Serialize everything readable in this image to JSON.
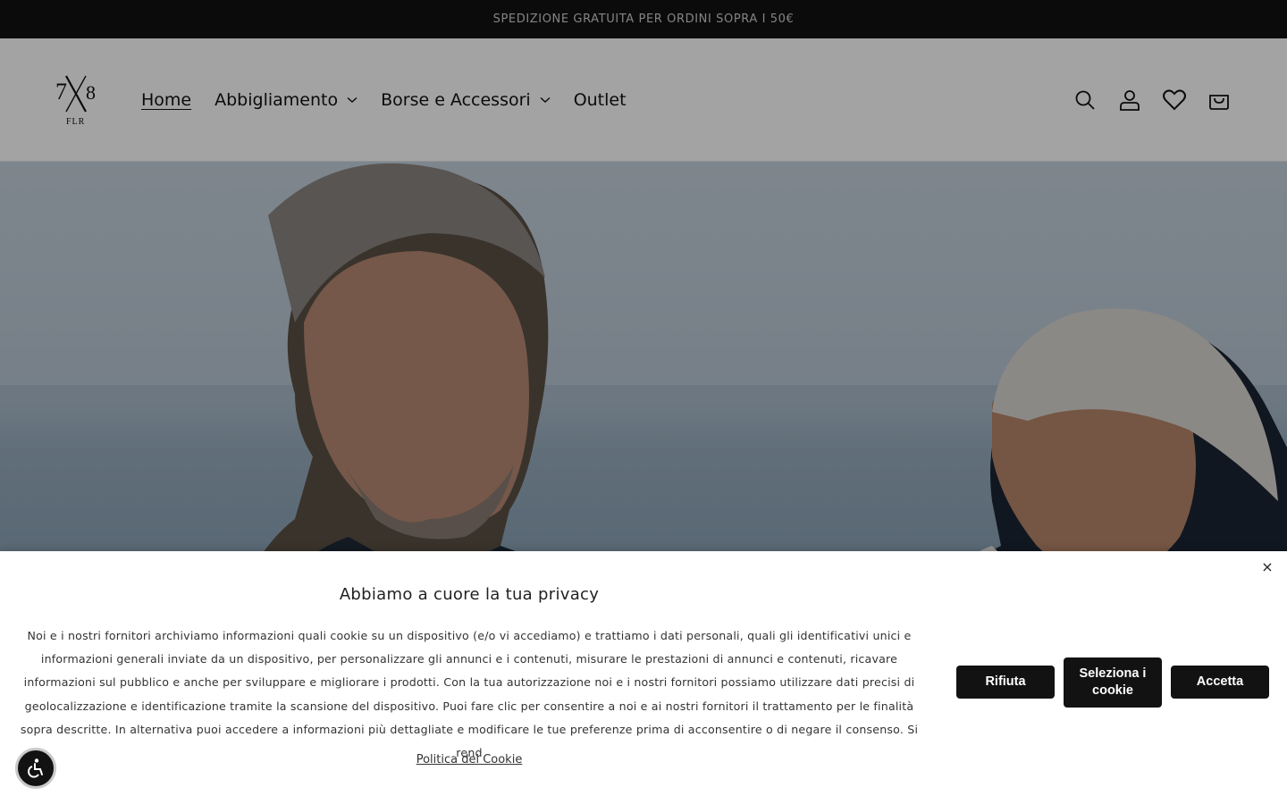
{
  "announcement": {
    "text": "SPEDIZIONE GRATUITA PER ORDINI SOPRA I 50€"
  },
  "header": {
    "logo_alt": "7X8 FLR",
    "nav": [
      {
        "label": "Home",
        "active": true,
        "dropdown": false
      },
      {
        "label": "Abbigliamento",
        "active": false,
        "dropdown": true
      },
      {
        "label": "Borse e Accessori",
        "active": false,
        "dropdown": true
      },
      {
        "label": "Outlet",
        "active": false,
        "dropdown": false
      }
    ],
    "icons": [
      "search-icon",
      "account-icon",
      "wishlist-icon",
      "cart-icon"
    ]
  },
  "hero": {
    "image": "two men by the sea"
  },
  "cookie": {
    "title": "Abbiamo a cuore la tua privacy",
    "text": "Noi e i nostri fornitori archiviamo informazioni quali cookie su un dispositivo (e/o vi accediamo) e trattiamo i dati personali, quali gli identificativi unici e informazioni generali inviate da un dispositivo, per personalizzare gli annunci e i contenuti, misurare le prestazioni di annunci e contenuti, ricavare informazioni sul pubblico e anche per sviluppare e migliorare i prodotti. Con la tua autorizzazione noi e i nostri fornitori possiamo utilizzare dati precisi di geolocalizzazione e identificazione tramite la scansione del dispositivo. Puoi fare clic per consentire a noi e ai nostri fornitori il trattamento per le finalità sopra descritte. In alternativa puoi accedere a informazioni più dettagliate e modificare le tue preferenze prima di acconsentire o di negare il consenso. Si rend",
    "link": "Politica dei Cookie",
    "close": "×",
    "buttons": {
      "reject": "Rifiuta",
      "select": "Seleziona i cookie",
      "accept": "Accetta"
    }
  },
  "colors": {
    "dark": "#121212",
    "overlay": "rgba(0,0,0,0.36)",
    "white": "#ffffff"
  }
}
